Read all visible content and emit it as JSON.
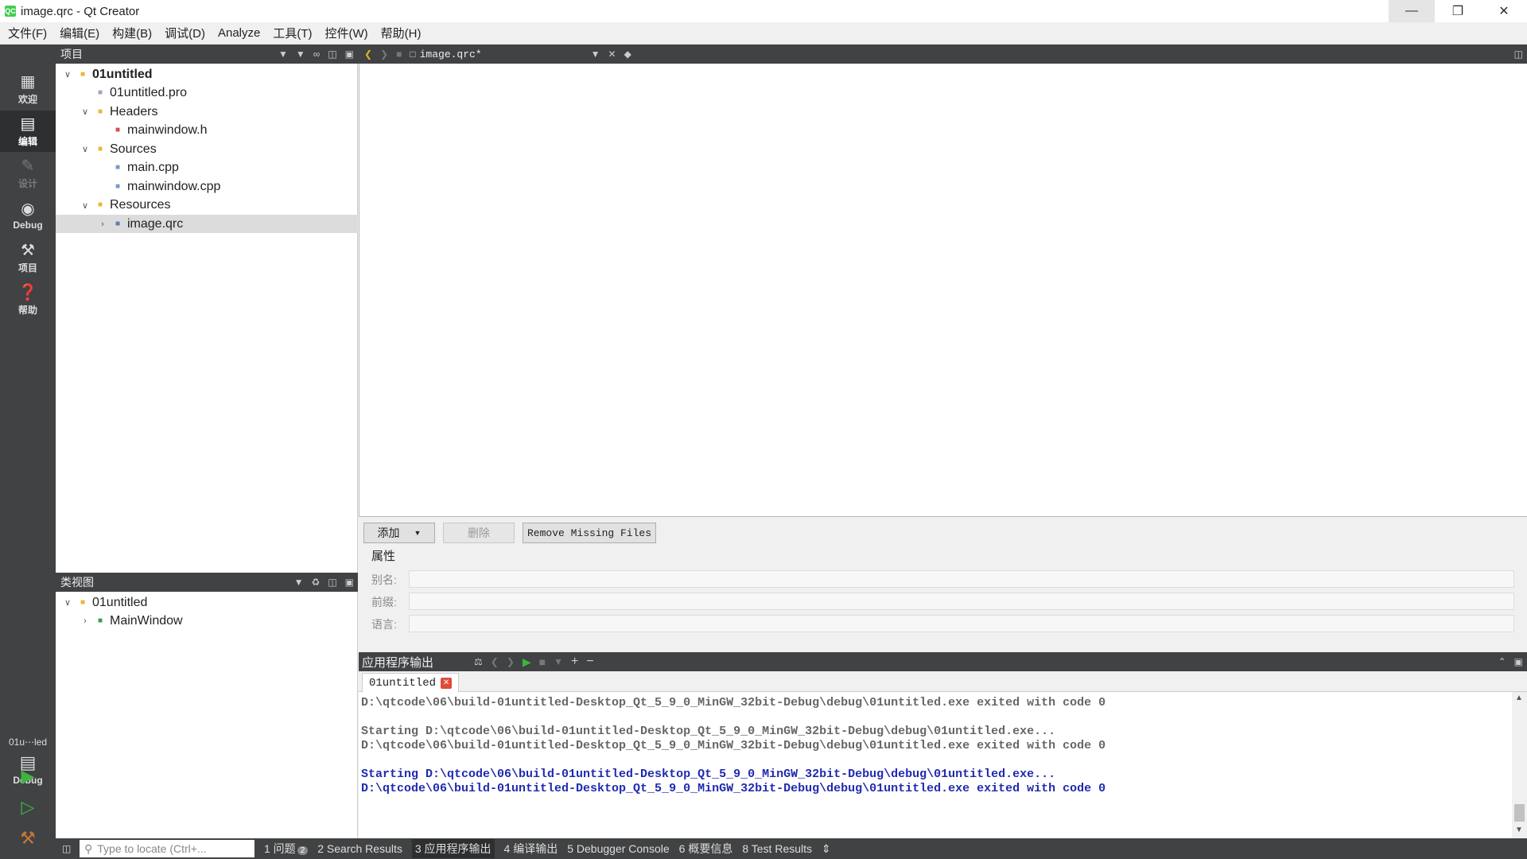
{
  "window": {
    "title": "image.qrc - Qt Creator",
    "app_icon": "QC"
  },
  "menu": [
    "文件(F)",
    "编辑(E)",
    "构建(B)",
    "调试(D)",
    "Analyze",
    "工具(T)",
    "控件(W)",
    "帮助(H)"
  ],
  "modes": [
    {
      "label": "欢迎",
      "icon": "grid-icon"
    },
    {
      "label": "编辑",
      "icon": "edit-icon"
    },
    {
      "label": "设计",
      "icon": "pencil-icon"
    },
    {
      "label": "Debug",
      "icon": "bug-icon"
    },
    {
      "label": "项目",
      "icon": "wrench-icon"
    },
    {
      "label": "帮助",
      "icon": "help-icon"
    }
  ],
  "kit": {
    "project": "01u⋯led",
    "build": "Debug"
  },
  "project_panel": {
    "title": "项目",
    "tree": [
      {
        "label": "01untitled",
        "level": 0,
        "arrow": "v",
        "bold": true
      },
      {
        "label": "01untitled.pro",
        "level": 1,
        "arrow": ""
      },
      {
        "label": "Headers",
        "level": 1,
        "arrow": "v"
      },
      {
        "label": "mainwindow.h",
        "level": 2,
        "arrow": ""
      },
      {
        "label": "Sources",
        "level": 1,
        "arrow": "v"
      },
      {
        "label": "main.cpp",
        "level": 2,
        "arrow": ""
      },
      {
        "label": "mainwindow.cpp",
        "level": 2,
        "arrow": ""
      },
      {
        "label": "Resources",
        "level": 1,
        "arrow": "v"
      },
      {
        "label": "image.qrc",
        "level": 2,
        "arrow": ">",
        "selected": true
      }
    ]
  },
  "editor_tab": {
    "filename": "image.qrc*"
  },
  "class_panel": {
    "title": "类视图",
    "tree": [
      {
        "label": "01untitled",
        "level": 0,
        "arrow": "v"
      },
      {
        "label": "MainWindow",
        "level": 1,
        "arrow": ">"
      }
    ]
  },
  "resource_editor": {
    "add": "添加",
    "remove": "删除",
    "remove_missing": "Remove Missing Files",
    "properties_title": "属性",
    "alias_label": "别名:",
    "prefix_label": "前缀:",
    "language_label": "语言:"
  },
  "output": {
    "title": "应用程序输出",
    "tab": "01untitled",
    "lines": [
      {
        "text": "D:\\qtcode\\06\\build-01untitled-Desktop_Qt_5_9_0_MinGW_32bit-Debug\\debug\\01untitled.exe exited with code 0",
        "style": "gray"
      },
      {
        "text": "",
        "style": "gray"
      },
      {
        "text": "Starting D:\\qtcode\\06\\build-01untitled-Desktop_Qt_5_9_0_MinGW_32bit-Debug\\debug\\01untitled.exe...",
        "style": "gray"
      },
      {
        "text": "D:\\qtcode\\06\\build-01untitled-Desktop_Qt_5_9_0_MinGW_32bit-Debug\\debug\\01untitled.exe exited with code 0",
        "style": "gray"
      },
      {
        "text": "",
        "style": "gray"
      },
      {
        "text": "Starting D:\\qtcode\\06\\build-01untitled-Desktop_Qt_5_9_0_MinGW_32bit-Debug\\debug\\01untitled.exe...",
        "style": "blue"
      },
      {
        "text": "D:\\qtcode\\06\\build-01untitled-Desktop_Qt_5_9_0_MinGW_32bit-Debug\\debug\\01untitled.exe exited with code 0",
        "style": "blue"
      }
    ]
  },
  "statusbar": {
    "locator_placeholder": "Type to locate (Ctrl+...",
    "items": [
      {
        "label": "1 问题",
        "badge": "2"
      },
      {
        "label": "2 Search Results"
      },
      {
        "label": "3 应用程序输出",
        "active": true
      },
      {
        "label": "4 编译输出"
      },
      {
        "label": "5 Debugger Console"
      },
      {
        "label": "6 概要信息"
      },
      {
        "label": "8 Test Results"
      }
    ]
  },
  "colors": {
    "sidebar": "#404244",
    "output_blue": "#1f2ab0",
    "run_green": "#3fb33f"
  }
}
